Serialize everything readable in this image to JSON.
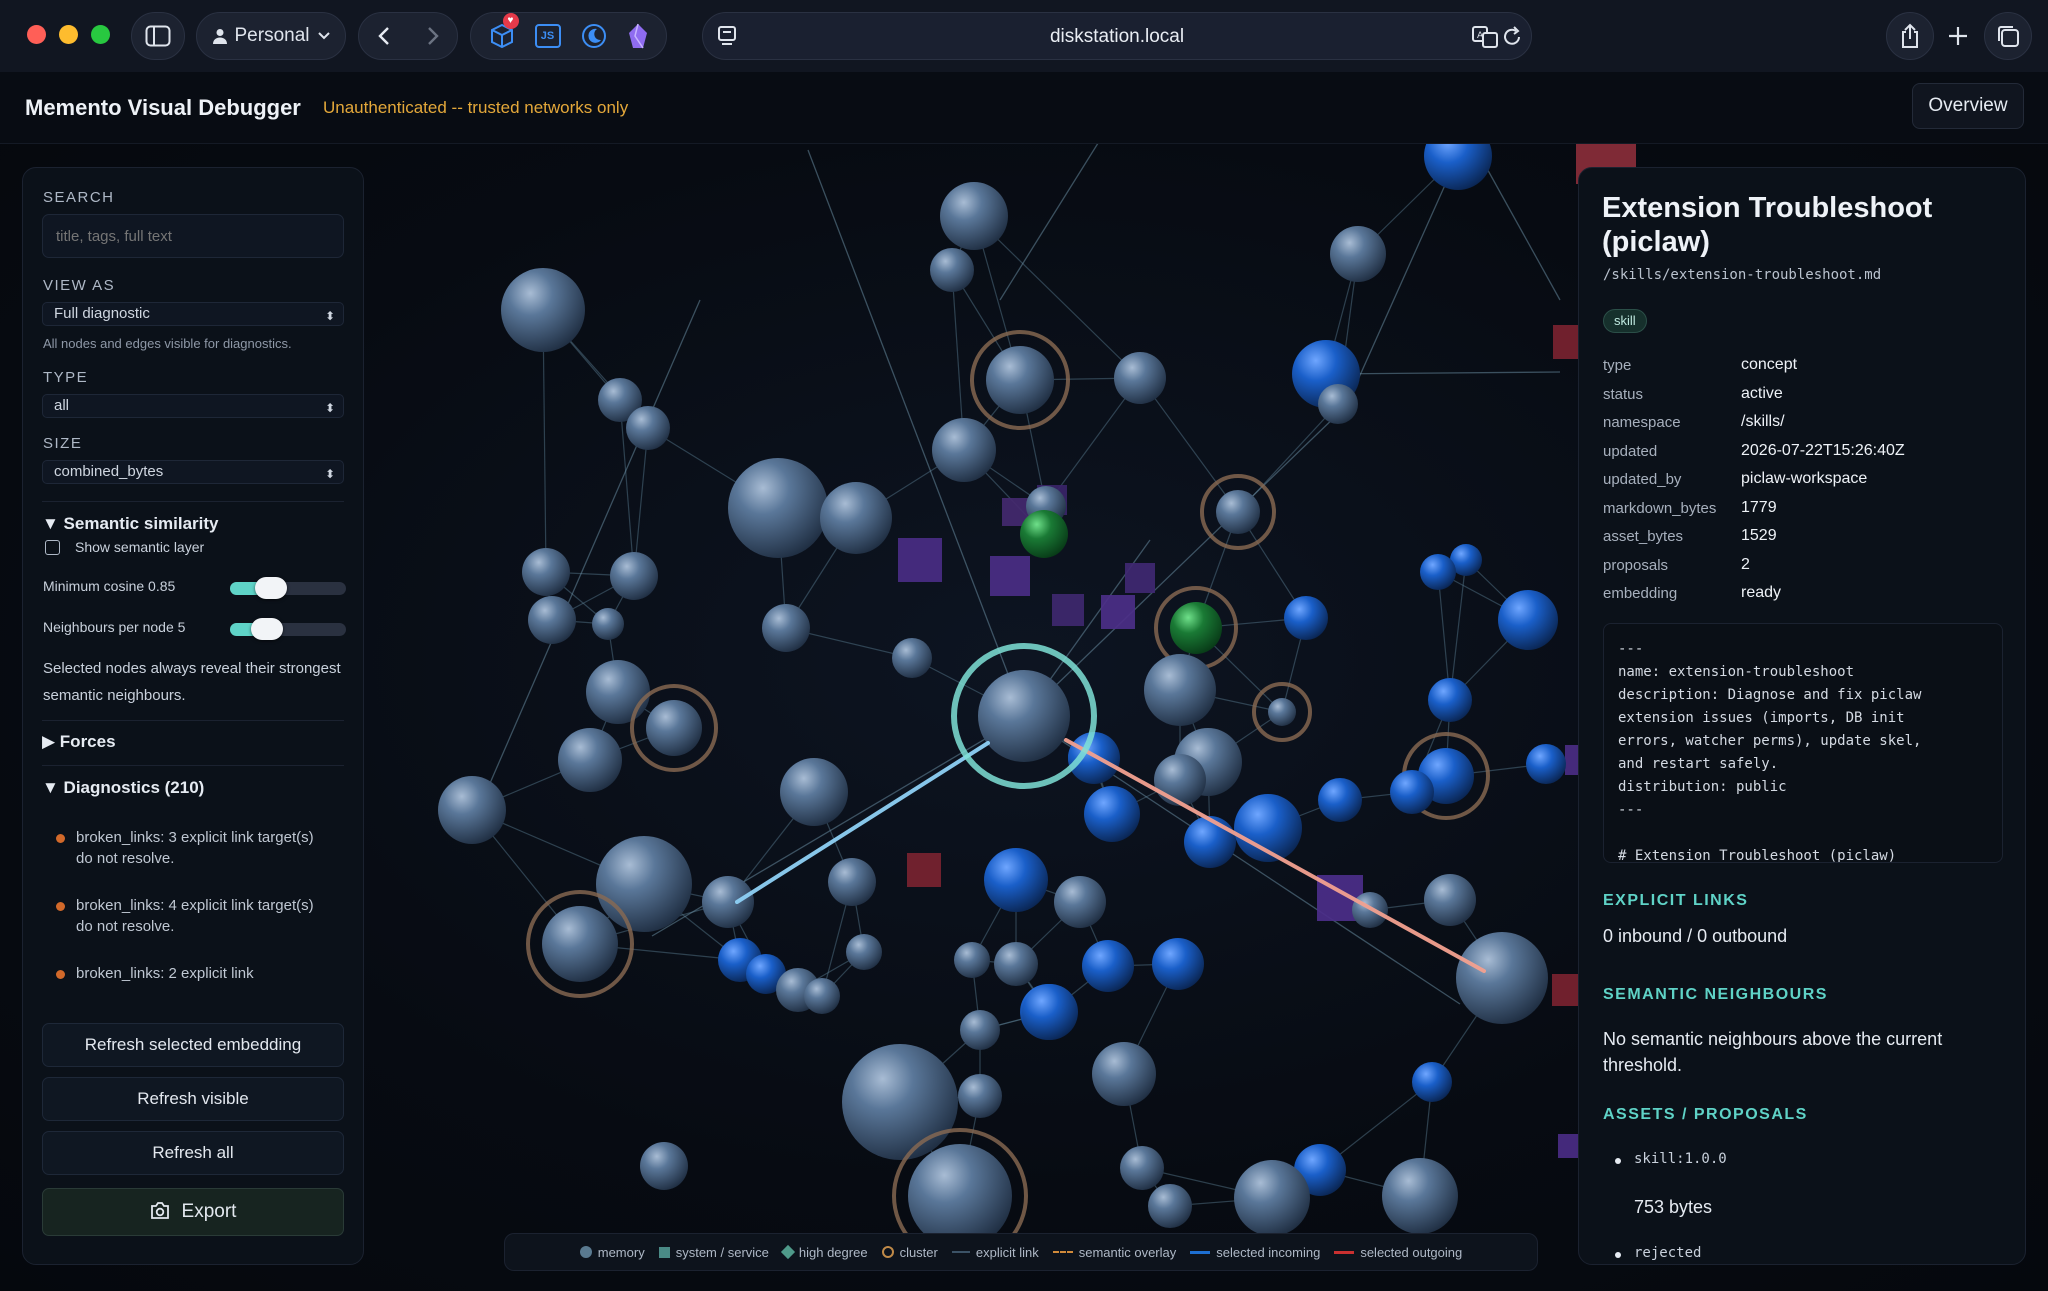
{
  "browser": {
    "profile": "Personal",
    "url": "diskstation.local"
  },
  "app": {
    "title": "Memento Visual Debugger",
    "warning": "Unauthenticated -- trusted networks only",
    "overview_label": "Overview"
  },
  "left": {
    "search_label": "SEARCH",
    "search_placeholder": "title, tags, full text",
    "view_as_label": "VIEW AS",
    "view_as_value": "Full diagnostic",
    "view_as_hint": "All nodes and edges visible for diagnostics.",
    "type_label": "TYPE",
    "type_value": "all",
    "size_label": "SIZE",
    "size_value": "combined_bytes",
    "semantic_title": "▼ Semantic similarity",
    "semantic_checkbox": "Show semantic layer",
    "min_cosine_label": "Minimum cosine 0.85",
    "min_cosine_fraction": 0.3,
    "neighbours_label": "Neighbours per node 5",
    "neighbours_fraction": 0.25,
    "semantic_note": "Selected nodes always reveal their strongest semantic neighbours.",
    "forces_title": "▶ Forces",
    "diagnostics_title": "▼ Diagnostics (210)",
    "diagnostics": [
      "broken_links: 3 explicit link target(s) do not resolve.",
      "broken_links: 4 explicit link target(s) do not resolve.",
      "broken_links: 2 explicit link"
    ],
    "buttons": {
      "refresh_selected": "Refresh selected embedding",
      "refresh_visible": "Refresh visible",
      "refresh_all": "Refresh all",
      "export": "Export"
    }
  },
  "right": {
    "title": "Extension Troubleshoot (piclaw)",
    "path": "/skills/extension-troubleshoot.md",
    "tag": "skill",
    "props": [
      {
        "k": "type",
        "v": "concept"
      },
      {
        "k": "status",
        "v": "active"
      },
      {
        "k": "namespace",
        "v": "/skills/"
      },
      {
        "k": "updated",
        "v": "2026-07-22T15:26:40Z"
      },
      {
        "k": "updated_by",
        "v": "piclaw-workspace"
      },
      {
        "k": "markdown_bytes",
        "v": "1779"
      },
      {
        "k": "asset_bytes",
        "v": "1529"
      },
      {
        "k": "proposals",
        "v": "2"
      },
      {
        "k": "embedding",
        "v": "ready"
      }
    ],
    "code": "---\nname: extension-troubleshoot\ndescription: Diagnose and fix piclaw\nextension issues (imports, DB init\nerrors, watcher perms), update skel,\nand restart safely.\ndistribution: public\n---\n\n# Extension Troubleshoot (piclaw)",
    "explicit_links_heading": "EXPLICIT LINKS",
    "explicit_links_text": "0 inbound / 0 outbound",
    "semantic_heading": "SEMANTIC NEIGHBOURS",
    "semantic_text": "No semantic neighbours above the current threshold.",
    "assets_heading": "ASSETS / PROPOSALS",
    "asset_item": "skill:1.0.0",
    "asset_size": "753 bytes",
    "proposal_item": "rejected"
  },
  "legend": {
    "memory": "memory",
    "system": "system / service",
    "high_degree": "high degree",
    "cluster": "cluster",
    "explicit": "explicit link",
    "semantic": "semantic overlay",
    "incoming": "selected incoming",
    "outgoing": "selected outgoing"
  },
  "colors": {
    "accent": "#5fd3c7",
    "warning": "#e4a83a",
    "memory_node": "#4d6a8c",
    "high_degree_node": "#1c64c8",
    "system_node": "#4a3488",
    "incoming_edge": "#7fc4f0",
    "outgoing_edge": "#f29a8a",
    "diagnostic_dot": "#d2692a"
  }
}
